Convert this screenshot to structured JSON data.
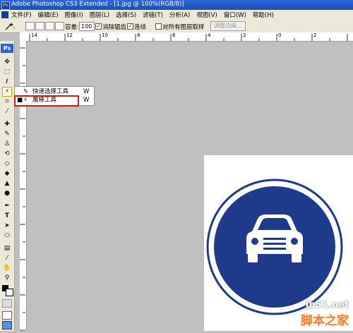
{
  "window": {
    "title": "Adobe Photoshop CS3 Extended - [1.jpg @ 100%(RGB/8)]"
  },
  "menu": {
    "items": [
      "文件(F)",
      "编辑(E)",
      "图像(I)",
      "图层(L)",
      "选择(S)",
      "滤镜(T)",
      "分析(A)",
      "视图(V)",
      "窗口(W)",
      "帮助(H)"
    ]
  },
  "options": {
    "tolerance_label": "容差:",
    "tolerance_value": "100",
    "antialias_label": "消除锯齿",
    "contiguous_label": "连续",
    "all_layers_label": "对所有图层取样",
    "refine_edge_label": "调整边缘..."
  },
  "toolbox": {
    "logo": "Ps"
  },
  "ruler": {
    "h_labels": [
      "14",
      "12",
      "10",
      "8",
      "6",
      "4",
      "2",
      "0",
      "2"
    ]
  },
  "flyout": {
    "items": [
      {
        "label": "快速选择工具",
        "shortcut": "W",
        "active": false
      },
      {
        "label": "魔棒工具",
        "shortcut": "W",
        "active": true
      }
    ],
    "bullet": "■"
  },
  "document": {
    "sign_color": "#1e3a8a",
    "sign": "car-sign"
  },
  "watermark": {
    "line1": "jb51.net",
    "line2": "脚本之家"
  }
}
